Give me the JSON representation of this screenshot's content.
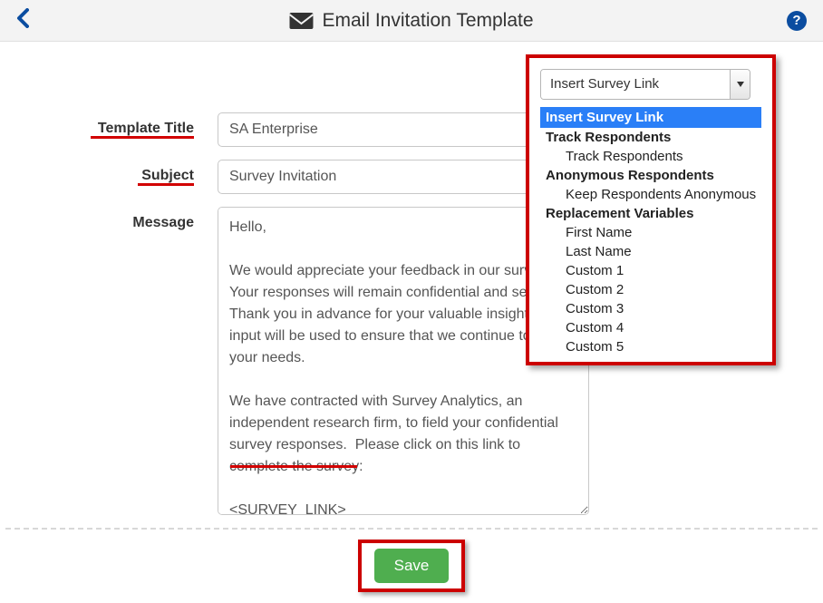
{
  "header": {
    "title": "Email Invitation Template"
  },
  "form": {
    "template_title_label": "Template Title",
    "template_title_value": "SA Enterprise",
    "subject_label": "Subject",
    "subject_value": "Survey Invitation",
    "message_label": "Message",
    "message_value": "Hello,\n\nWe would appreciate your feedback in our survey. Your responses will remain confidential and secure. Thank you in advance for your valuable insights. Your input will be used to ensure that we continue to meet your needs.\n\nWe have contracted with Survey Analytics, an independent research firm, to field your confidential survey responses.  Please click on this link to complete the survey:\n\n<SURVEY_LINK>\n\nPlease contact sa.india@surveyanalytics.com with any questions."
  },
  "dropdown": {
    "selected_text": "Insert Survey Link",
    "option_insert_link": "Insert Survey Link",
    "group_track_header": "Track Respondents",
    "option_track": "Track Respondents",
    "group_anon_header": "Anonymous Respondents",
    "option_anon": "Keep Respondents Anonymous",
    "group_vars_header": "Replacement Variables",
    "option_first_name": "First Name",
    "option_last_name": "Last Name",
    "option_custom1": "Custom 1",
    "option_custom2": "Custom 2",
    "option_custom3": "Custom 3",
    "option_custom4": "Custom 4",
    "option_custom5": "Custom 5"
  },
  "footer": {
    "save_label": "Save"
  }
}
